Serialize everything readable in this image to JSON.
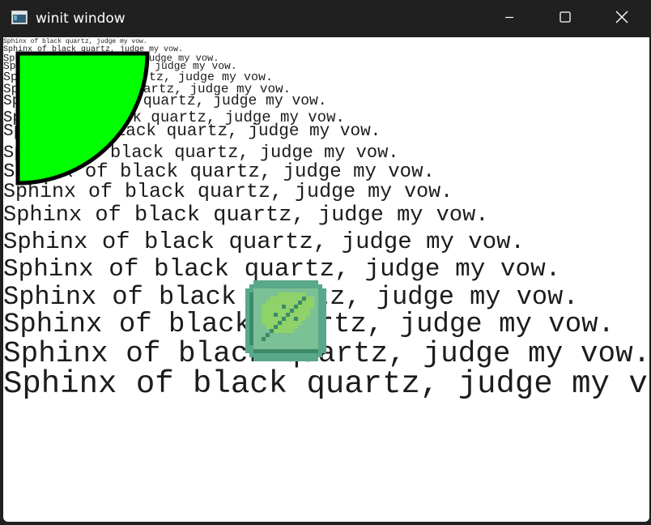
{
  "window": {
    "title": "winit window",
    "icons": {
      "app": "window-app-icon",
      "minimize": "minimize-icon",
      "maximize": "maximize-icon",
      "close": "close-icon"
    }
  },
  "canvas": {
    "background": "#ffffff",
    "text_color": "#1c1c1c",
    "sample_text": "Sphinx of black quartz, judge my vow.",
    "shape": {
      "fill": "#00ff00",
      "stroke": "#000000",
      "description_icon": "quarter-circle-shape"
    },
    "sprite": {
      "name": "leaf-sprite-icon",
      "colors": {
        "outer": "#5aa88a",
        "inner": "#7cc096",
        "leaf": "#8fd26a",
        "vein": "#3d8a6a"
      }
    }
  }
}
